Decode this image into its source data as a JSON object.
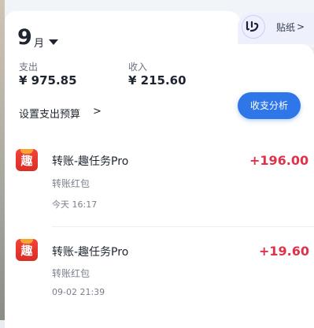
{
  "header": {
    "month_number": "9",
    "month_unit": "月",
    "month_dropdown_icon": "caret-down-icon"
  },
  "sticker": {
    "label": "贴纸",
    "chevron": ">",
    "avatar_icon": "face-avatar-icon"
  },
  "summary": {
    "expense_label": "支出",
    "expense_value": "¥ 975.85",
    "income_label": "收入",
    "income_value": "¥ 215.60",
    "budget_link": "设置支出预算",
    "budget_chevron": ">",
    "analysis_button": "收支分析"
  },
  "transactions": [
    {
      "title": "转账-趣任务Pro",
      "subtitle": "转账红包",
      "time": "今天 16:17",
      "amount": "+196.00",
      "icon_glyph": "趣",
      "icon": "qu-app-icon"
    },
    {
      "title": "转账-趣任务Pro",
      "subtitle": "转账红包",
      "time": "09-02 21:39",
      "amount": "+19.60",
      "icon_glyph": "趣",
      "icon": "qu-app-icon"
    }
  ],
  "colors": {
    "accent": "#2f77e8",
    "income_amount": "#e0334a",
    "icon_red": "#e3342c"
  }
}
